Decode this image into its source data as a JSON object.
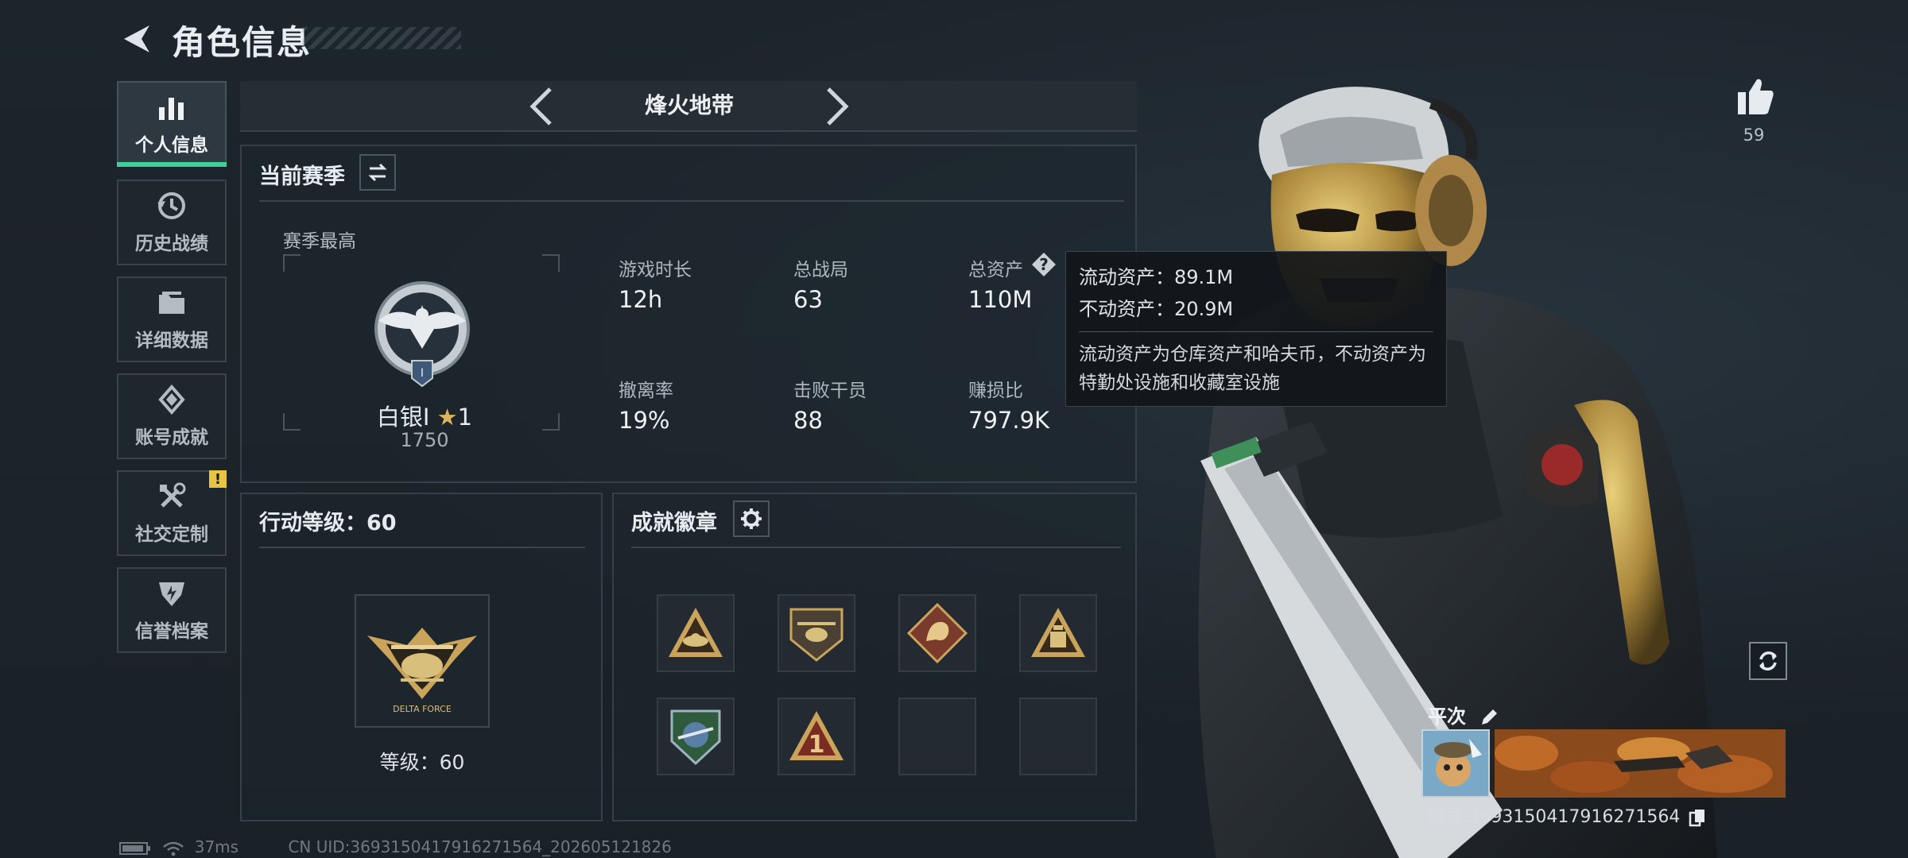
{
  "header": {
    "title": "角色信息"
  },
  "sidebar": {
    "items": [
      {
        "label": "个人信息",
        "icon": "bar-chart-icon",
        "active": true
      },
      {
        "label": "历史战绩",
        "icon": "history-clock-icon",
        "active": false
      },
      {
        "label": "详细数据",
        "icon": "folder-icon",
        "active": false
      },
      {
        "label": "账号成就",
        "icon": "achievement-diamond-icon",
        "active": false
      },
      {
        "label": "社交定制",
        "icon": "wrench-tools-icon",
        "active": false,
        "badge": "!"
      },
      {
        "label": "信誉档案",
        "icon": "shield-emblem-icon",
        "active": false
      }
    ]
  },
  "mode": {
    "name": "烽火地带"
  },
  "season": {
    "title": "当前赛季",
    "best_label": "赛季最高",
    "rank_name": "白银Ⅰ",
    "rank_stars": "1",
    "rank_points": "1750",
    "stats": [
      {
        "label": "游戏时长",
        "value": "12h"
      },
      {
        "label": "总战局",
        "value": "63"
      },
      {
        "label": "总资产",
        "value": "110M",
        "has_help": true
      },
      {
        "label": "撤离率",
        "value": "19%"
      },
      {
        "label": "击败干员",
        "value": "88"
      },
      {
        "label": "赚损比",
        "value": "797.9K"
      }
    ]
  },
  "tooltip": {
    "liquid": "流动资产：89.1M",
    "fixed": "不动资产：20.9M",
    "note": "流动资产为仓库资产和哈夫币，不动资产为特勤处设施和收藏室设施"
  },
  "action_level": {
    "title": "行动等级：60",
    "level_text": "等级：60",
    "emblem_text": "DELTA FORCE"
  },
  "badges": {
    "title": "成就徽章",
    "slots": [
      "hat-badge",
      "helicopter-badge",
      "dragon-badge",
      "bottle-badge",
      "globe-badge",
      "number-one-badge",
      "empty",
      "empty"
    ]
  },
  "profile": {
    "likes": "59",
    "name": "平次",
    "id_text": "编号:3693150417916271564"
  },
  "status": {
    "ping": "37ms",
    "uid": "CN UID:3693150417916271564_202605121826"
  },
  "colors": {
    "accent_green": "#3fcf9a",
    "badge_gold": "#c9a45a",
    "warning_yellow": "#e8c440"
  }
}
